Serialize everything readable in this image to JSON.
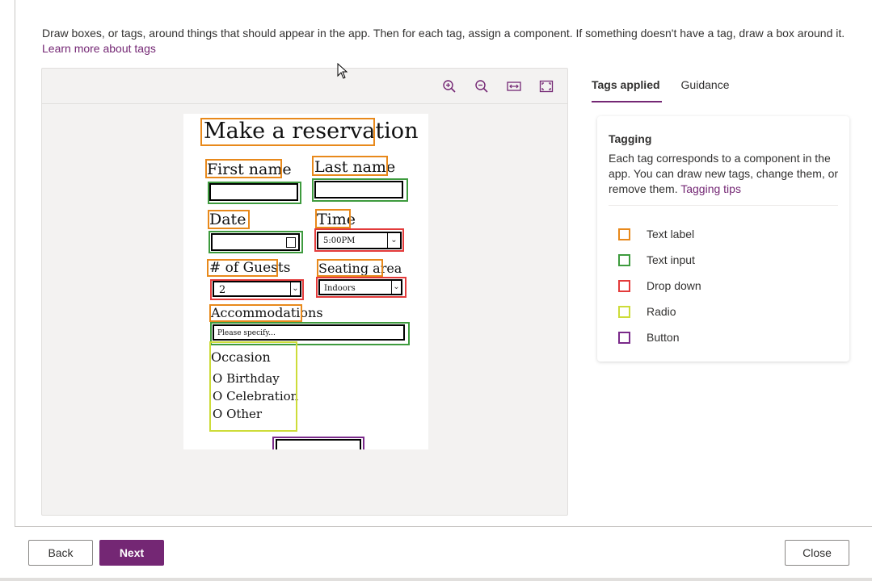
{
  "intro": {
    "text": "Draw boxes, or tags, around things that should appear in the app. Then for each tag, assign a component. If something doesn't have a tag, draw a box around it.",
    "link": "Learn more about tags"
  },
  "toolbar": {
    "icons": [
      "zoom-in-icon",
      "zoom-out-icon",
      "fit-width-icon",
      "fit-page-icon"
    ]
  },
  "sketch": {
    "title": "Make a reservation",
    "first_name": "First name",
    "last_name": "Last name",
    "date": "Date",
    "time": "Time",
    "time_value": "5:00PM",
    "guests": "# of Guests",
    "guests_value": "2",
    "seating": "Seating area",
    "seating_value": "Indoors",
    "accommodations": "Accommodations",
    "accommodations_placeholder": "Please specify...",
    "occasion": "Occasion",
    "occasion_options": [
      "O Birthday",
      "O Celebration",
      "O Other"
    ]
  },
  "tabs": [
    {
      "label": "Tags applied",
      "active": true
    },
    {
      "label": "Guidance",
      "active": false
    }
  ],
  "card": {
    "title": "Tagging",
    "desc": "Each tag corresponds to a component in the app. You can draw new tags, change them, or remove them.",
    "link": "Tagging tips",
    "legend": [
      {
        "label": "Text label",
        "color": "#e8891b"
      },
      {
        "label": "Text input",
        "color": "#3e9b3e"
      },
      {
        "label": "Drop down",
        "color": "#e33b3b"
      },
      {
        "label": "Radio",
        "color": "#cddc39"
      },
      {
        "label": "Button",
        "color": "#7a2a8a"
      }
    ]
  },
  "footer": {
    "back": "Back",
    "next": "Next",
    "close": "Close"
  },
  "colors": {
    "accent": "#742774",
    "text_label": "#e8891b",
    "text_input": "#3e9b3e",
    "drop_down": "#e33b3b",
    "radio": "#cddc39",
    "button": "#7a2a8a"
  }
}
